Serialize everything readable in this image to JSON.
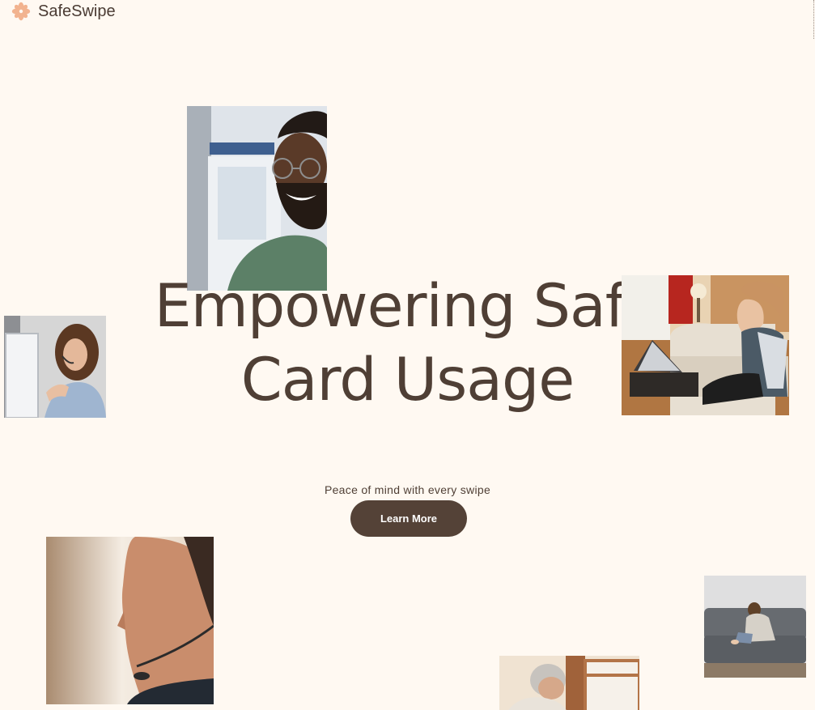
{
  "header": {
    "brand_name": "SafeSwipe",
    "logo_icon": "flower-icon",
    "logo_color": "#f2b38f"
  },
  "hero": {
    "title_line1": "Empowering Safe",
    "title_line2": "Card Usage",
    "tagline": "Peace of mind with every swipe",
    "cta_label": "Learn More"
  },
  "colors": {
    "background": "#fff9f2",
    "text": "#4f3f35",
    "button": "#544237",
    "button_text": "#ffffff"
  }
}
